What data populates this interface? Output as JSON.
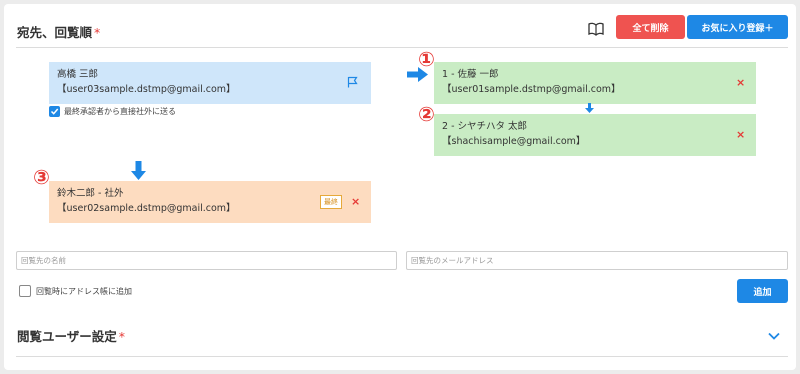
{
  "header": {
    "title": "宛先、回覧順",
    "required_mark": "*",
    "clear_all_label": "全て削除",
    "favorite_add_label": "お気に入り登録＋"
  },
  "sender": {
    "name": "高橋 三郎",
    "email": "【user03sample.dstmp@gmail.com】",
    "direct_send_label": "最終承認者から直接社外に送る",
    "direct_send_checked": true
  },
  "recipients": [
    {
      "step": "①",
      "line1": "1 - 佐藤 一郎",
      "line2": "【user01sample.dstmp@gmail.com】",
      "remove": "×"
    },
    {
      "step": "②",
      "line1": "2 - シヤチハタ 太郎",
      "line2": "【shachisample@gmail.com】",
      "remove": "×"
    },
    {
      "step": "③",
      "line1": "鈴木二郎 - 社外",
      "line2": "【user02sample.dstmp@gmail.com】",
      "badge": "最終",
      "remove": "×"
    }
  ],
  "form": {
    "name_placeholder": "回覧先の名前",
    "email_placeholder": "回覧先のメールアドレス",
    "addressbook_label": "回覧時にアドレス帳に追加",
    "addressbook_checked": false,
    "add_label": "追加"
  },
  "viewer_section": {
    "title": "閲覧ユーザー設定",
    "required_mark": "*"
  },
  "colors": {
    "accent_blue": "#1e88e5",
    "danger_red": "#ef5350",
    "sender_card": "#cfe6fa",
    "recipient_card": "#c9ecc4",
    "external_card": "#fddcc0"
  }
}
